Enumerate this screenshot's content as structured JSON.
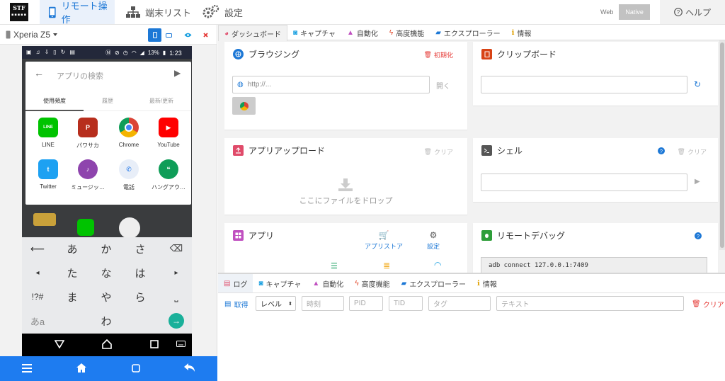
{
  "nav": {
    "logo": "STF",
    "tabs": [
      {
        "label": "リモート操作",
        "icon": "mobile-icon",
        "active": true
      },
      {
        "label": "端末リスト",
        "icon": "sitemap-icon"
      },
      {
        "label": "設定",
        "icon": "gears-icon"
      }
    ],
    "mode": {
      "web": "Web",
      "native": "Native",
      "selected": "Native"
    },
    "help": "ヘルプ"
  },
  "device": {
    "name": "Xperia Z5",
    "status": {
      "battery": "13%",
      "time": "1:23"
    },
    "launcher": {
      "search_placeholder": "アプリの検索",
      "tabs": [
        "使用頻度",
        "履歴",
        "最新/更新"
      ],
      "apps": [
        {
          "label": "LINE",
          "color": "#00c300",
          "glyph": "LINE"
        },
        {
          "label": "パワサカ",
          "color": "#b72e1d",
          "glyph": "P"
        },
        {
          "label": "Chrome",
          "color": "#4285f4",
          "glyph": "C"
        },
        {
          "label": "YouTube",
          "color": "#ff0000",
          "glyph": "▶"
        },
        {
          "label": "Twitter",
          "color": "#1da1f2",
          "glyph": "t"
        },
        {
          "label": "ミュージッ…",
          "color": "#8e44ad",
          "glyph": "♪"
        },
        {
          "label": "電話",
          "color": "#1a73e8",
          "glyph": "✆"
        },
        {
          "label": "ハングアウ…",
          "color": "#0f9d58",
          "glyph": "❝"
        }
      ]
    },
    "keyboard": {
      "main_keys": [
        "あ",
        "か",
        "さ",
        "た",
        "な",
        "は",
        "ま",
        "や",
        "ら",
        "",
        "わ",
        ""
      ],
      "side_left": [
        "⟵",
        "◂",
        "!?#",
        "あa"
      ],
      "side_right": [
        "⌫",
        "▸",
        "⎵",
        "→"
      ]
    },
    "bottom_icons": [
      "menu-icon",
      "home-icon",
      "square-icon",
      "back-icon"
    ]
  },
  "tabs": [
    {
      "label": "ダッシュボード",
      "icon": "dashboard-icon",
      "color": "#e04b6a",
      "active": true
    },
    {
      "label": "キャプチャ",
      "icon": "camera-icon",
      "color": "#1aa0e0"
    },
    {
      "label": "自動化",
      "icon": "road-icon",
      "color": "#c050c0"
    },
    {
      "label": "高度機能",
      "icon": "bolt-icon",
      "color": "#e04020"
    },
    {
      "label": "エクスプローラー",
      "icon": "folder-icon",
      "color": "#1d78d6"
    },
    {
      "label": "情報",
      "icon": "info-icon",
      "color": "#e0a000"
    }
  ],
  "cards": {
    "browsing": {
      "title": "ブラウジング",
      "reset": "初期化",
      "url_placeholder": "http://...",
      "open": "開く"
    },
    "clipboard": {
      "title": "クリップボード"
    },
    "upload": {
      "title": "アプリアップロード",
      "clear": "クリア",
      "drop": "ここにファイルをドロップ"
    },
    "shell": {
      "title": "シェル",
      "clear": "クリア"
    },
    "apps": {
      "title": "アプリ",
      "store": "アプリストア",
      "settings": "設定"
    },
    "remote": {
      "title": "リモートデバッグ",
      "command": "adb connect 127.0.0.1:7409"
    }
  },
  "log": {
    "tabs": [
      {
        "label": "ログ",
        "icon": "list-icon",
        "color": "#e04b6a",
        "active": true
      },
      {
        "label": "キャプチャ",
        "icon": "camera-icon",
        "color": "#1aa0e0"
      },
      {
        "label": "自動化",
        "icon": "road-icon",
        "color": "#c050c0"
      },
      {
        "label": "高度機能",
        "icon": "bolt-icon",
        "color": "#e04020"
      },
      {
        "label": "エクスプローラー",
        "icon": "folder-icon",
        "color": "#1d78d6"
      },
      {
        "label": "情報",
        "icon": "info-icon",
        "color": "#e0a000"
      }
    ],
    "get": "取得",
    "level": "レベル",
    "filters": {
      "time": "時刻",
      "pid": "PID",
      "tid": "TID",
      "tag": "タグ",
      "text": "テキスト"
    },
    "clear": "クリア"
  },
  "colors": {
    "accent": "#1d78d6",
    "danger": "#e53935",
    "bottom_bar": "#1e7cf0"
  }
}
